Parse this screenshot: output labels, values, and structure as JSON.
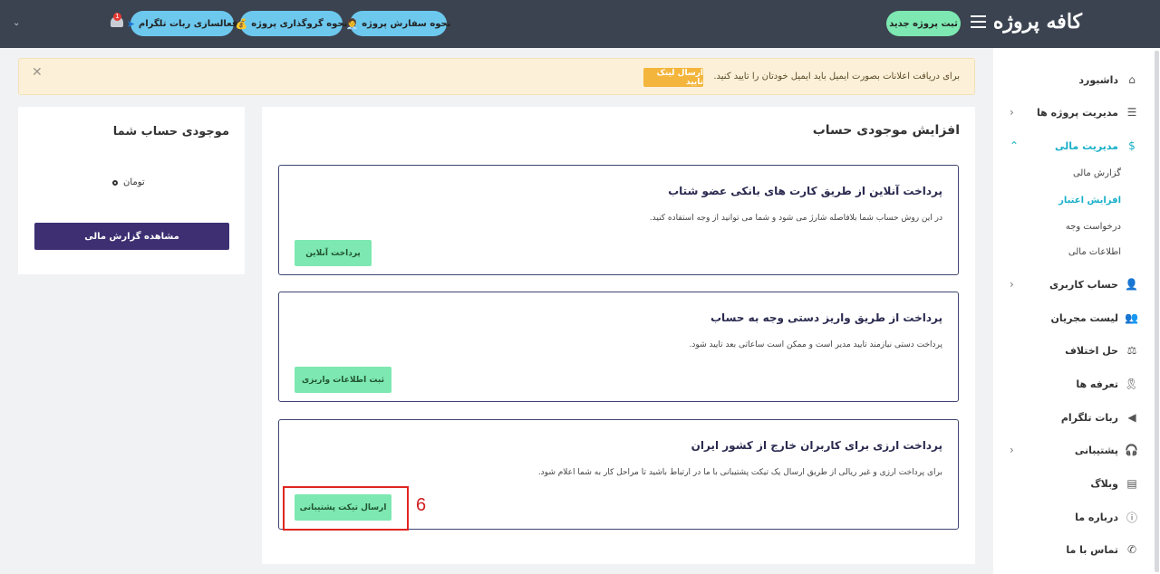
{
  "header": {
    "logo": "کافه پروژه",
    "new_project": "ثبت پروژه جدید",
    "btn_order": "نحوه سفارش پروژه",
    "btn_order_icon": "🧑‍💼",
    "btn_assign": "نحوه گروگذاری پروژه",
    "btn_assign_icon": "💰",
    "btn_telegram": "فعالسازی ربات تلگرام",
    "btn_telegram_icon": "➤",
    "notification_count": "1",
    "user_caret": "⌄"
  },
  "alert": {
    "text": "برای دریافت اعلانات بصورت ایمیل باید ایمیل خودتان را تایید کنید.",
    "button": "ارسال لینک تایید",
    "close": "✕"
  },
  "sidebar": {
    "items": [
      {
        "label": "داشبورد",
        "icon": "⌂"
      },
      {
        "label": "مدیریت پروژه ها",
        "icon": "☰",
        "arrow": "‹"
      },
      {
        "label": "مدیریت مالی",
        "icon": "$",
        "arrow": "⌃"
      },
      {
        "label": "حساب کاربری",
        "icon": "👤",
        "arrow": "‹"
      },
      {
        "label": "لیست مجریان",
        "icon": "👥"
      },
      {
        "label": "حل اختلاف",
        "icon": "⚖"
      },
      {
        "label": "تعرفه ها",
        "icon": "🎗"
      },
      {
        "label": "ربات تلگرام",
        "icon": "◀"
      },
      {
        "label": "پشتیبانی",
        "icon": "🎧",
        "arrow": "‹"
      },
      {
        "label": "وبلاگ",
        "icon": "▤"
      },
      {
        "label": "درباره ما",
        "icon": "ⓘ"
      },
      {
        "label": "تماس با ما",
        "icon": "✆"
      }
    ],
    "sub_items": [
      {
        "label": "گزارش مالی"
      },
      {
        "label": "افزایش اعتبار"
      },
      {
        "label": "درخواست وجه"
      },
      {
        "label": "اطلاعات مالی"
      }
    ]
  },
  "balance": {
    "title": "موجودی حساب شما",
    "unit": "تومان",
    "button": "مشاهده گزارش مالی"
  },
  "main": {
    "title": "افزایش موجودی حساب",
    "cards": [
      {
        "title": "پرداخت آنلاین از طریق کارت های بانکی عضو شتاب",
        "desc": "در این روش حساب شما بلافاصله شارژ می شود و شما می توانید از وجه استفاده کنید.",
        "button": "پرداخت آنلاین"
      },
      {
        "title": "پرداخت از طریق واریز دستی وجه به حساب",
        "desc": "پرداخت دستی نیازمند تایید مدیر است و ممکن است ساعاتی بعد تایید شود.",
        "button": "ثبت اطلاعات واریزی"
      },
      {
        "title": "پرداخت ارزی برای کاربران خارج از کشور ایران",
        "desc": "برای پرداخت ارزی و غیر ریالی از طریق ارسال یک تیکت پشتیبانی با ما در ارتباط باشید تا مراحل کار به شما اعلام شود.",
        "button": "ارسال تیکت پشتیبانی"
      }
    ]
  },
  "annotation": {
    "step": "6",
    "color": "#e0251f"
  },
  "colors": {
    "accent": "#1ab0c9",
    "green_button": "#7de8b1",
    "header_bg": "#3b4350",
    "purple_button": "#3e2f72"
  }
}
